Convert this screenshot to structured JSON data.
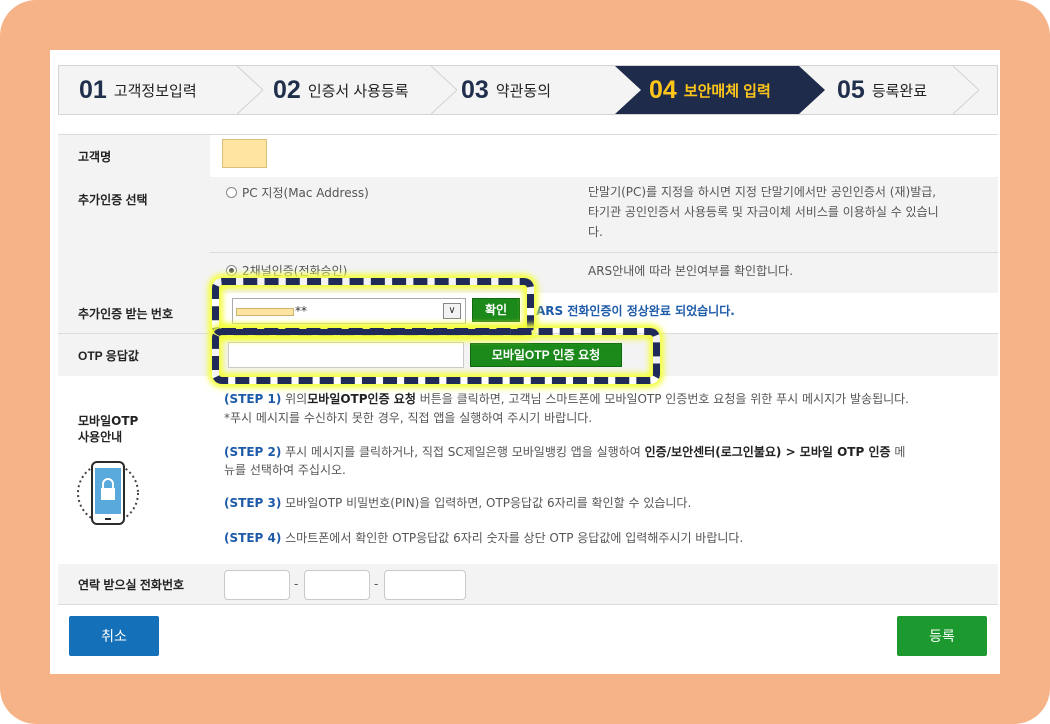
{
  "steps": [
    {
      "num": "01",
      "label": "고객정보입력"
    },
    {
      "num": "02",
      "label": "인증서 사용등록"
    },
    {
      "num": "03",
      "label": "약관동의"
    },
    {
      "num": "04",
      "label": "보안매체 입력"
    },
    {
      "num": "05",
      "label": "등록완료"
    }
  ],
  "form": {
    "customer_name_label": "고객명",
    "extra_auth_label": "추가인증 선택",
    "pc_option": "PC 지정(Mac Address)",
    "pc_desc_1": "단말기(PC)를 지정을 하시면 지정 단말기에서만 공인인증서 (재)발급,",
    "pc_desc_2": "타기관 공인인증서 사용등록 및 자금이체 서비스를 이용하실 수 있습니",
    "pc_desc_3": "다.",
    "ars_option": "2채널인증(전화승인)",
    "ars_desc": "ARS안내에 따라 본인여부를 확인합니다.",
    "extra_number_label": "추가인증 받는 번호",
    "phone_masked": "**",
    "confirm_button": "확인",
    "ars_complete_msg": "ARS 전화인증이 정상완료 되었습니다.",
    "otp_label": "OTP 응답값",
    "otp_request_button": "모바일OTP 인증 요청",
    "mobile_otp_guide_1": "모바일OTP",
    "mobile_otp_guide_2": "사용안내",
    "step1_tag": "(STEP 1)",
    "step1_a": " 위의",
    "step1_bold": "모바일OTP인증 요청",
    "step1_b": " 버튼을 클릭하면, 고객님 스마트폰에 모바일OTP 인증번호 요청을 위한 푸시 메시지가 발송됩니다.",
    "step1_c": "*푸시 메시지를 수신하지 못한 경우, 직접 앱을 실행하여 주시기 바랍니다.",
    "step2_tag": "(STEP 2)",
    "step2_a": " 푸시 메시지를 클릭하거나, 직접 SC제일은행 모바일뱅킹 앱을 실행하여 ",
    "step2_bold": "인증/보안센터(로그인불요) > 모바일 OTP 인증",
    "step2_b": " 메",
    "step2_c": "뉴를 선택하여 주십시오.",
    "step3_tag": "(STEP 3)",
    "step3_a": " 모바일OTP 비밀번호(PIN)을 입력하면, OTP응답값 6자리를 확인할 수 있습니다.",
    "step4_tag": "(STEP 4)",
    "step4_a": " 스마트폰에서 확인한 OTP응답값 6자리 숫자를 상단 OTP 응답값에 입력해주시기 바랍니다.",
    "contact_label": "연락 받으실 전화번호",
    "dash1": "-",
    "dash2": "-"
  },
  "buttons": {
    "cancel": "취소",
    "register": "등록"
  },
  "colors": {
    "frame": "#f6b388",
    "active_step_bg": "#1e2b4a",
    "active_step_text": "#ffc61a",
    "green": "#1b8a1b",
    "blue": "#1470b8",
    "highlight": "#f4ff3c"
  }
}
